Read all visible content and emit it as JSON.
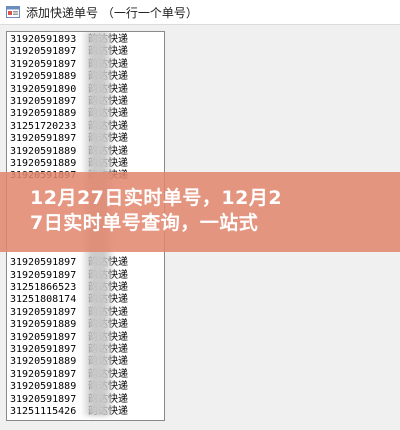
{
  "window": {
    "title": "添加快递单号 （一行一个单号）"
  },
  "icons": {
    "app": "app-window-icon"
  },
  "list": {
    "rows": [
      {
        "number": "31920591893",
        "carrier": "韵达快递"
      },
      {
        "number": "31920591897",
        "carrier": "韵达快递"
      },
      {
        "number": "31920591897",
        "carrier": "韵达快递"
      },
      {
        "number": "31920591889",
        "carrier": "韵达快递"
      },
      {
        "number": "31920591890",
        "carrier": "韵达快递"
      },
      {
        "number": "31920591897",
        "carrier": "韵达快递"
      },
      {
        "number": "31920591889",
        "carrier": "韵达快递"
      },
      {
        "number": "31251720233",
        "carrier": "韵达快递"
      },
      {
        "number": "31920591897",
        "carrier": "韵达快递"
      },
      {
        "number": "31920591889",
        "carrier": "韵达快递"
      },
      {
        "number": "31920591889",
        "carrier": "韵达快递"
      },
      {
        "number": "31920591897",
        "carrier": "韵达快递"
      },
      {
        "number": "",
        "carrier": ""
      },
      {
        "number": "",
        "carrier": ""
      },
      {
        "number": "",
        "carrier": ""
      },
      {
        "number": "",
        "carrier": ""
      },
      {
        "number": "",
        "carrier": ""
      },
      {
        "number": "",
        "carrier": ""
      },
      {
        "number": "31920591897",
        "carrier": "韵达快递"
      },
      {
        "number": "31920591897",
        "carrier": "韵达快递"
      },
      {
        "number": "31251866523",
        "carrier": "韵达快递"
      },
      {
        "number": "31251808174",
        "carrier": "韵达快递"
      },
      {
        "number": "31920591897",
        "carrier": "韵达快递"
      },
      {
        "number": "31920591889",
        "carrier": "韵达快递"
      },
      {
        "number": "31920591897",
        "carrier": "韵达快递"
      },
      {
        "number": "31920591897",
        "carrier": "韵达快递"
      },
      {
        "number": "31920591889",
        "carrier": "韵达快递"
      },
      {
        "number": "31920591897",
        "carrier": "韵达快递"
      },
      {
        "number": "31920591889",
        "carrier": "韵达快递"
      },
      {
        "number": "31920591897",
        "carrier": "韵达快递"
      },
      {
        "number": "31251115426",
        "carrier": "韵达快递"
      }
    ]
  },
  "banner": {
    "line1": "12月27日实时单号，12月2",
    "line2": "7日实时单号查询，一站式"
  }
}
